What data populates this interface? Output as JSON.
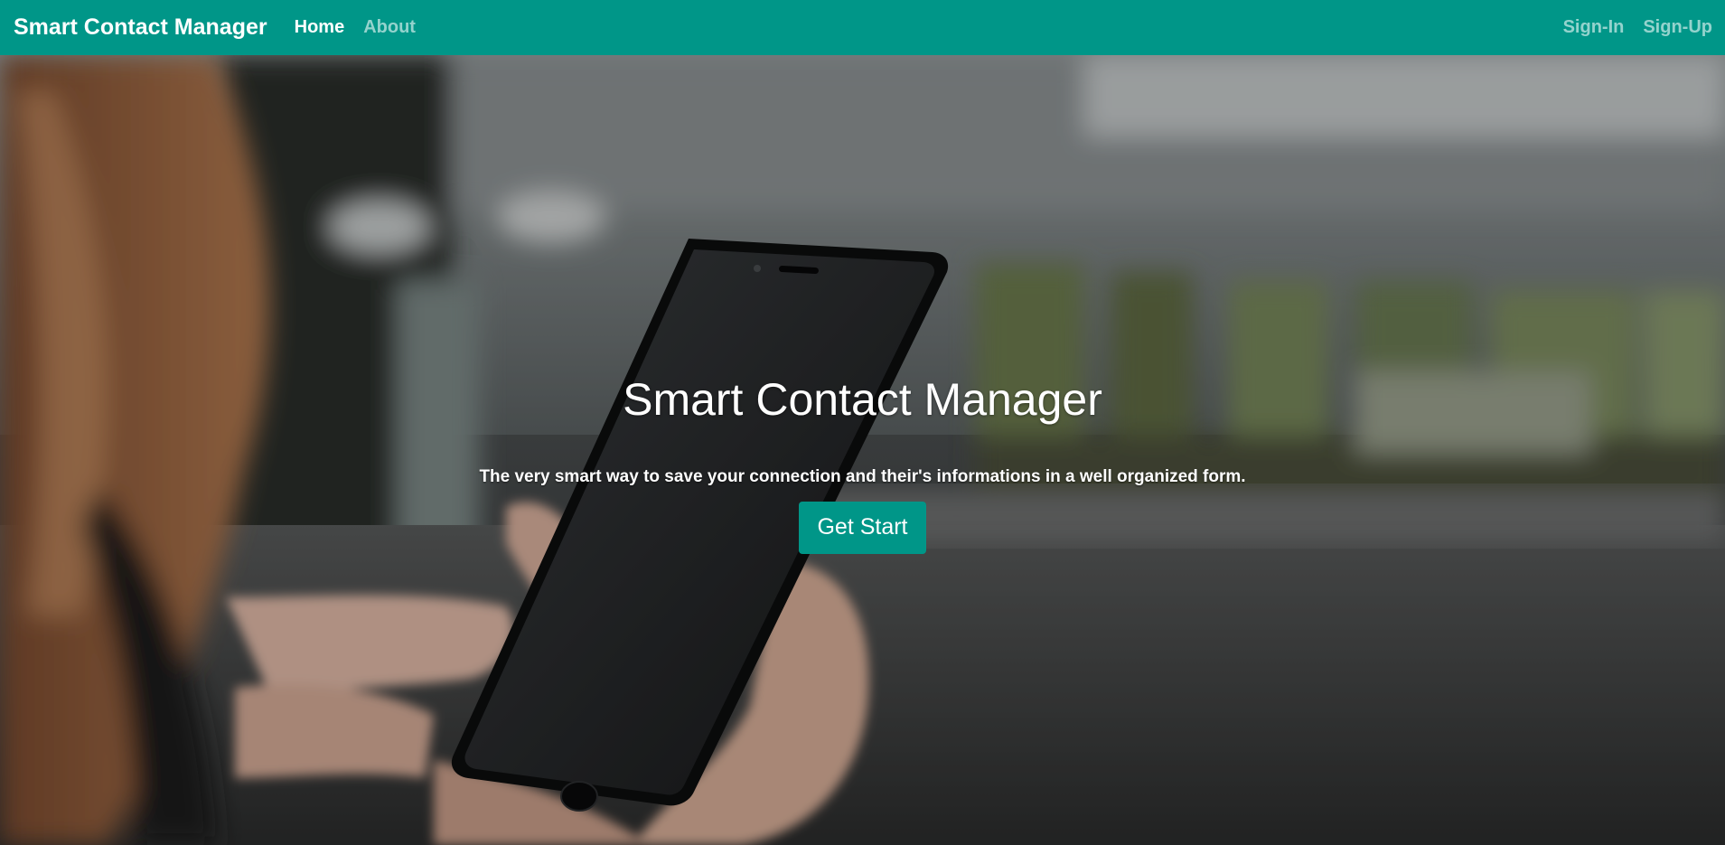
{
  "navbar": {
    "brand": "Smart Contact Manager",
    "left_links": [
      {
        "label": "Home",
        "active": true
      },
      {
        "label": "About",
        "active": false
      }
    ],
    "right_links": [
      {
        "label": "Sign-In"
      },
      {
        "label": "Sign-Up"
      }
    ]
  },
  "hero": {
    "title": "Smart Contact Manager",
    "subtitle": "The very smart way to save your connection and their's informations in a well organized form.",
    "button_label": "Get Start"
  },
  "colors": {
    "primary": "#009688",
    "text_light": "#ffffff"
  }
}
